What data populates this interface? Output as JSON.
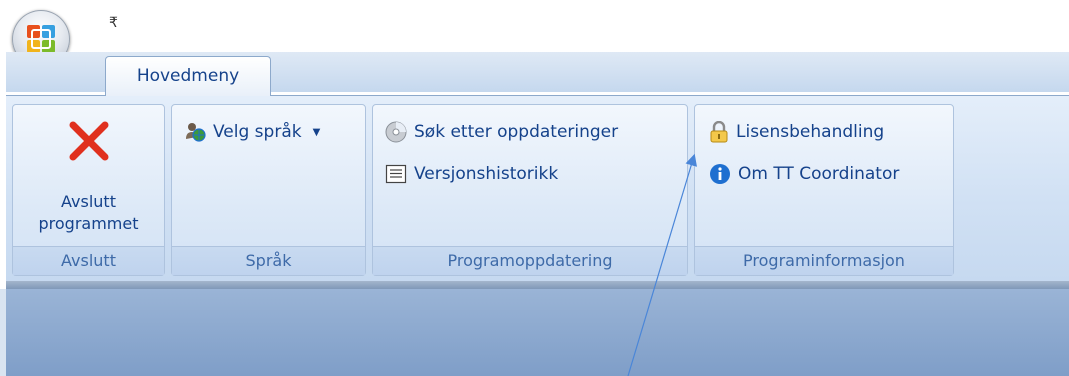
{
  "tabs": [
    {
      "label": "Hovedmeny"
    }
  ],
  "groups": {
    "avslutt": {
      "label": "Avslutt",
      "button_line1": "Avslutt",
      "button_line2": "programmet"
    },
    "sprak": {
      "label": "Språk",
      "velg_sprak": "Velg språk"
    },
    "programoppdatering": {
      "label": "Programoppdatering",
      "sok_etter": "Søk etter oppdateringer",
      "versjonshistorikk": "Versjonshistorikk"
    },
    "programinformasjon": {
      "label": "Programinformasjon",
      "lisensbehandling": "Lisensbehandling",
      "om": "Om TT Coordinator"
    }
  },
  "icons": {
    "orb": "office-logo-icon",
    "qat": "customize-quick-access-icon",
    "exit": "red-x-icon",
    "language": "language-people-icon",
    "update": "cd-disc-icon",
    "history": "document-list-icon",
    "license": "padlock-icon",
    "about": "info-icon"
  },
  "colors": {
    "ribbon_text": "#15428b",
    "group_label_text": "#3e6aa8",
    "exit_red": "#e0301e",
    "info_blue": "#1e6fd0",
    "annotation_line": "#4a86d8"
  }
}
